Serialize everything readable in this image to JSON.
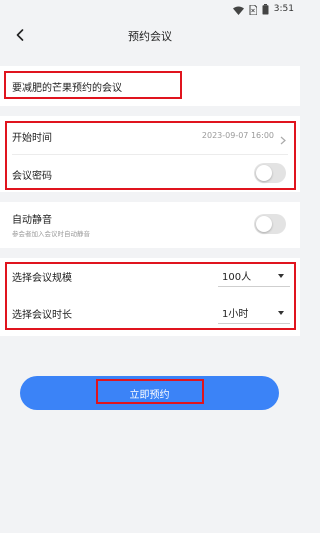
{
  "status_bar": {
    "time": "3:51",
    "icons": [
      "wifi-icon",
      "sim-icon",
      "battery-icon"
    ]
  },
  "header": {
    "title": "预约会议",
    "back_icon": "back-arrow-icon"
  },
  "meeting": {
    "title_value": "要减肥的芒果预约的会议"
  },
  "schedule": {
    "start_label": "开始时间",
    "start_value": "2023-09-07 16:00",
    "password_label": "会议密码",
    "password_enabled": false
  },
  "mute": {
    "label": "自动静音",
    "description": "参会者加入会议时自动静音",
    "enabled": false
  },
  "scale": {
    "label": "选择会议规模",
    "value": "100人"
  },
  "duration": {
    "label": "选择会议时长",
    "value": "1小时"
  },
  "actions": {
    "submit_label": "立即预约"
  },
  "colors": {
    "accent": "#3b83f7",
    "highlight": "#e0141e",
    "background": "#f2f3f5"
  }
}
